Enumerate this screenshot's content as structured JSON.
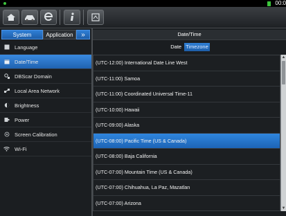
{
  "status": {
    "clock": "00:0"
  },
  "toolbar": {
    "buttons": [
      {
        "icon": "home-icon"
      },
      {
        "icon": "car-icon"
      },
      {
        "icon": "browser-icon"
      },
      {
        "icon": "info-icon"
      },
      {
        "icon": "screenshot-icon"
      }
    ]
  },
  "sidebar": {
    "tabs": {
      "system": "System",
      "application": "Application",
      "more": "»"
    },
    "items": [
      {
        "label": "Language",
        "icon": "language-icon"
      },
      {
        "label": "Date/Time",
        "icon": "calendar-icon",
        "active": true
      },
      {
        "label": "DBScar Domain",
        "icon": "domain-icon"
      },
      {
        "label": "Local Area Network",
        "icon": "network-icon"
      },
      {
        "label": "Brightness",
        "icon": "brightness-icon"
      },
      {
        "label": "Power",
        "icon": "power-icon"
      },
      {
        "label": "Screen Calibration",
        "icon": "calibration-icon"
      },
      {
        "label": "Wi-Fi",
        "icon": "wifi-icon"
      }
    ]
  },
  "content": {
    "title": "Date/Time",
    "tabs": {
      "date": "Date",
      "timezone": "Timezone"
    },
    "timezones": [
      "(UTC-12:00) International Date Line West",
      "(UTC-11:00) Samoa",
      "(UTC-11:00) Coordinated Universal Time-11",
      "(UTC-10:00) Hawaii",
      "(UTC-09:00) Alaska",
      "(UTC-08:00) Pacific Time (US & Canada)",
      "(UTC-08:00) Baja California",
      "(UTC-07:00) Mountain Time (US & Canada)",
      "(UTC-07:00) Chihuahua, La Paz, Mazatlan",
      "(UTC-07:00) Arizona"
    ],
    "selected_index": 5
  },
  "colors": {
    "accent": "#2f7fd6",
    "background": "#1a1d20"
  }
}
